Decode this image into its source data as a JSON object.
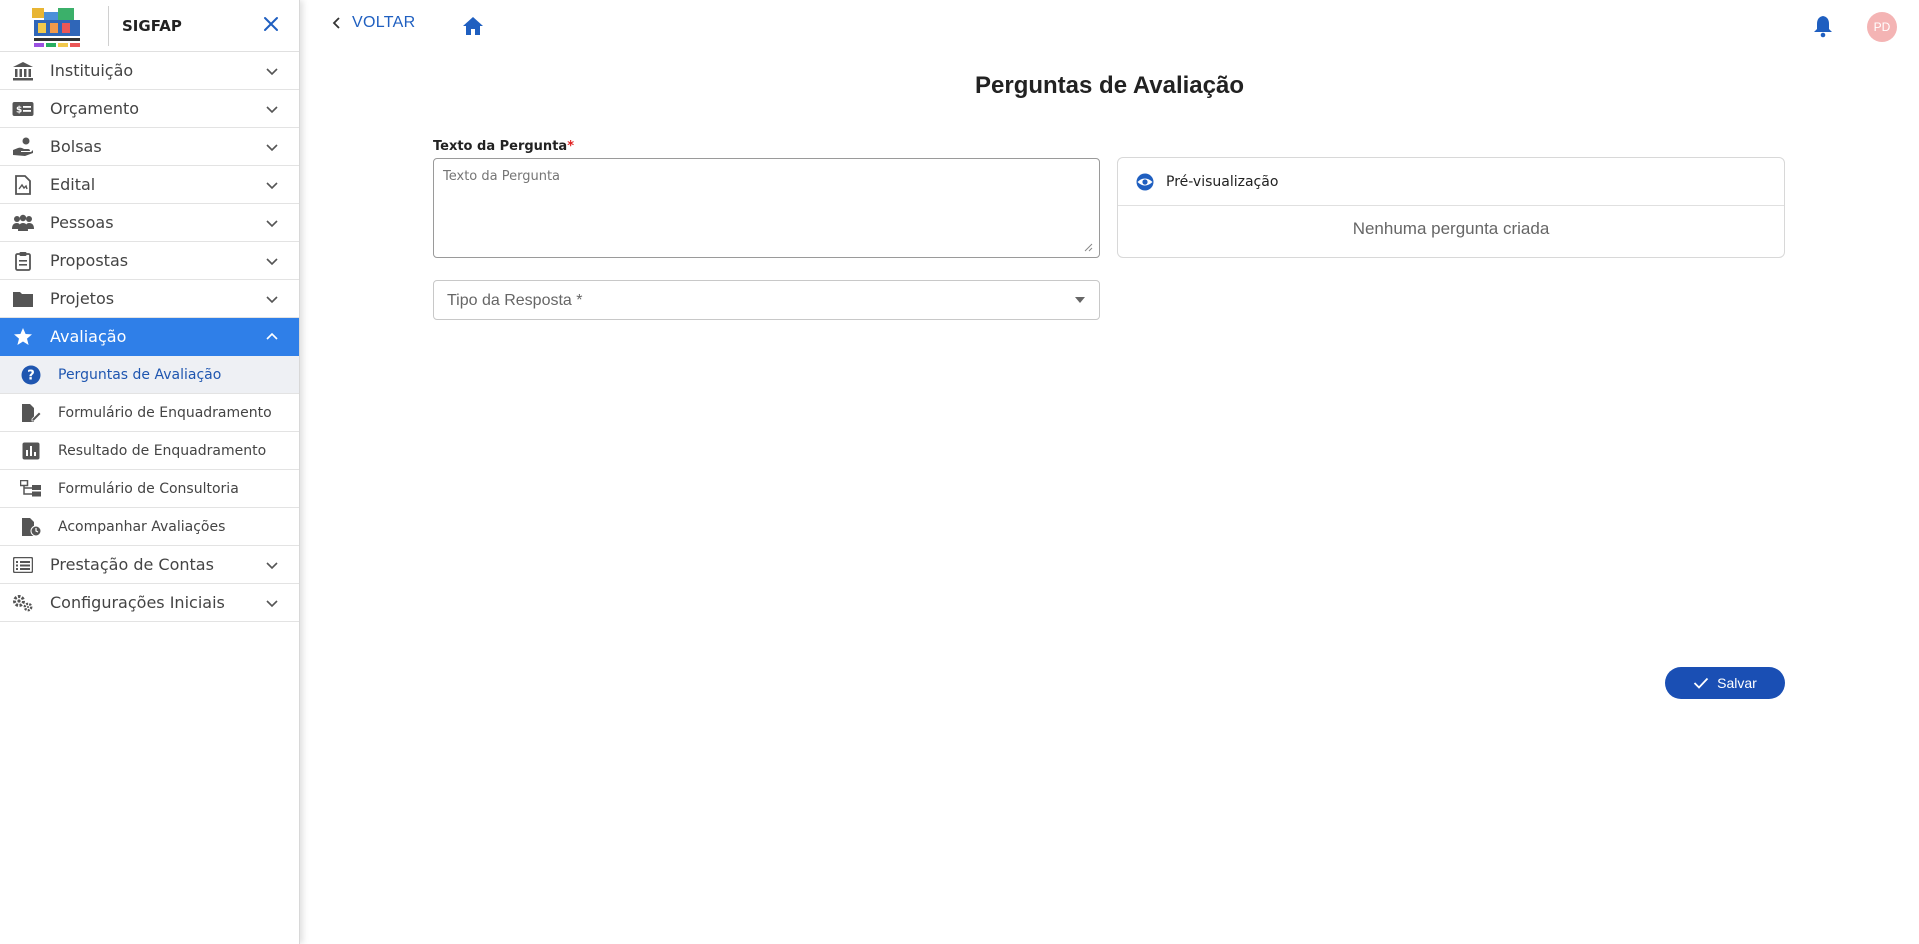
{
  "app": {
    "title": "SIGFAP"
  },
  "sidebar": {
    "items": [
      {
        "label": "Instituição",
        "icon": "bank-icon"
      },
      {
        "label": "Orçamento",
        "icon": "money-card-icon"
      },
      {
        "label": "Bolsas",
        "icon": "hand-coin-icon"
      },
      {
        "label": "Edital",
        "icon": "document-icon"
      },
      {
        "label": "Pessoas",
        "icon": "people-icon"
      },
      {
        "label": "Propostas",
        "icon": "clipboard-icon"
      },
      {
        "label": "Projetos",
        "icon": "folder-icon"
      },
      {
        "label": "Avaliação",
        "icon": "star-icon"
      },
      {
        "label": "Prestação de Contas",
        "icon": "list-icon"
      },
      {
        "label": "Configurações Iniciais",
        "icon": "gears-icon"
      }
    ],
    "subitems": [
      {
        "label": "Perguntas de Avaliação",
        "icon": "question-circle-icon"
      },
      {
        "label": "Formulário de Enquadramento",
        "icon": "file-edit-icon"
      },
      {
        "label": "Resultado de Enquadramento",
        "icon": "bar-chart-icon"
      },
      {
        "label": "Formulário de Consultoria",
        "icon": "tree-icon"
      },
      {
        "label": "Acompanhar Avaliações",
        "icon": "file-clock-icon"
      }
    ],
    "active_index": 7,
    "current_subitem_index": 0
  },
  "topbar": {
    "back_label": "VOLTAR",
    "avatar_initials": "PD"
  },
  "main": {
    "title": "Perguntas de Avaliação",
    "question_label": "Texto da Pergunta",
    "required_mark": "*",
    "question_placeholder": "Texto da Pergunta",
    "question_value": "",
    "preview_label": "Pré-visualização",
    "preview_empty": "Nenhuma pergunta criada",
    "answer_type_label": "Tipo da Resposta *",
    "save_label": "Salvar"
  },
  "colors": {
    "accent": "#2f7fe8",
    "link": "#1f5fc0",
    "save_button": "#1a4fb4",
    "avatar": "#f4b4b4",
    "required": "#e02020"
  }
}
